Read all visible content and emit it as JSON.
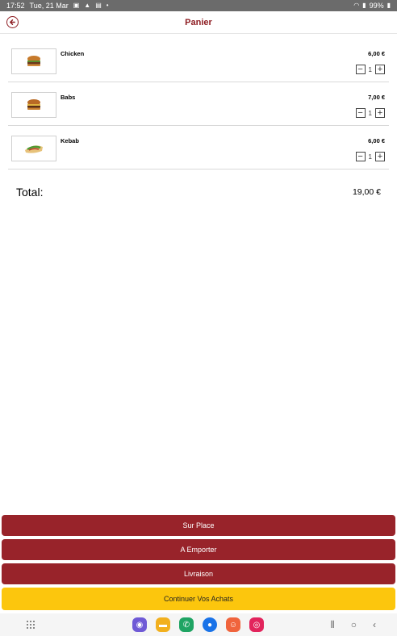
{
  "status_bar": {
    "time": "17:52",
    "date": "Tue, 21 Mar",
    "battery": "99%",
    "icons": [
      "image-icon",
      "notification-icon",
      "calendar-icon",
      "wifi-icon",
      "signal-icon",
      "battery-icon"
    ]
  },
  "app_bar": {
    "title": "Panier",
    "back_icon": "back-arrow-icon"
  },
  "cart": {
    "items": [
      {
        "name": "Chicken",
        "price": "6,00 €",
        "quantity": "1",
        "image": "burger-icon"
      },
      {
        "name": "Babs",
        "price": "7,00 €",
        "quantity": "1",
        "image": "burger-icon"
      },
      {
        "name": "Kebab",
        "price": "6,00 €",
        "quantity": "1",
        "image": "kebab-icon"
      }
    ],
    "minus_glyph": "−",
    "plus_glyph": "+"
  },
  "total": {
    "label": "Total:",
    "value": "19,00 €"
  },
  "actions": {
    "dine_in": "Sur Place",
    "takeaway": "A Emporter",
    "delivery": "Livraison",
    "continue": "Continuer Vos Achats"
  },
  "colors": {
    "brand": "#98232a",
    "accent": "#fcc60d",
    "title": "#8e1d22"
  },
  "nav_bar": {
    "dock_icons": [
      "internet-icon",
      "files-icon",
      "phone-icon",
      "messages-icon",
      "contacts-icon",
      "camera-icon"
    ]
  }
}
